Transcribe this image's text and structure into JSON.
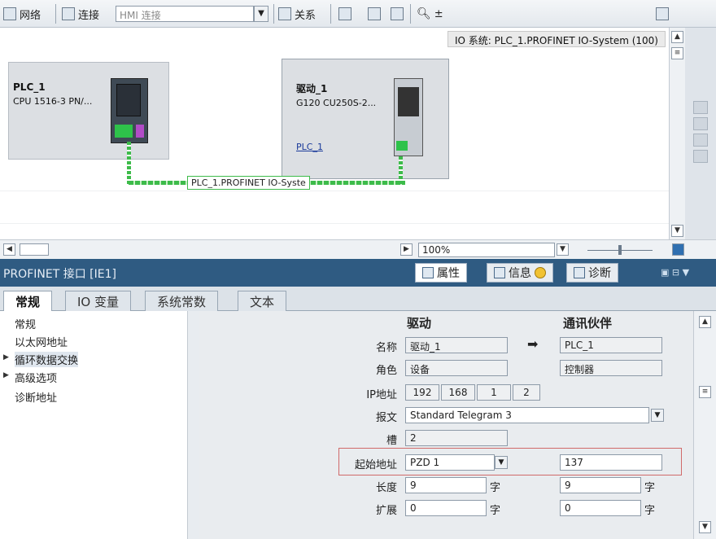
{
  "toolbar": {
    "network_label": "网络",
    "connections_label": "连接",
    "connection_select": "HMI 连接",
    "relations_label": "关系",
    "zoom_plus": "±"
  },
  "netview": {
    "io_system_label": "IO 系统: PLC_1.PROFINET IO-System (100)",
    "plc": {
      "name": "PLC_1",
      "model": "CPU 1516-3 PN/..."
    },
    "drive": {
      "name": "驱动_1",
      "model": "G120 CU250S-2...",
      "link": "PLC_1"
    },
    "network_label": "PLC_1.PROFINET IO-Syste"
  },
  "navbar": {
    "zoom": "100%"
  },
  "properties": {
    "title": "PROFINET 接口 [IE1]",
    "tab_properties": "属性",
    "tab_info": "信息",
    "tab_diagnostics": "诊断"
  },
  "tabs": [
    "常规",
    "IO 变量",
    "系统常数",
    "文本"
  ],
  "tree": [
    {
      "label": "常规",
      "arrow": ""
    },
    {
      "label": "以太网地址",
      "arrow": ""
    },
    {
      "label": "循环数据交换",
      "arrow": "▶"
    },
    {
      "label": "高级选项",
      "arrow": "▶"
    },
    {
      "label": "诊断地址",
      "arrow": ""
    }
  ],
  "exchange": {
    "col_drive": "驱动",
    "col_partner": "通讯伙伴",
    "rows": {
      "name": {
        "label": "名称",
        "drive": "驱动_1",
        "partner": "PLC_1"
      },
      "role": {
        "label": "角色",
        "drive": "设备",
        "partner": "控制器"
      },
      "ip": {
        "label": "IP地址",
        "o1": "192",
        "o2": "168",
        "o3": "1",
        "o4": "2"
      },
      "telegram": {
        "label": "报文",
        "value": "Standard Telegram 3"
      },
      "slot": {
        "label": "槽",
        "value": "2"
      },
      "start": {
        "label": "起始地址",
        "drive": "PZD 1",
        "partner": "137"
      },
      "length": {
        "label": "长度",
        "drive": "9",
        "partner": "9",
        "unit": "字"
      },
      "extension": {
        "label": "扩展",
        "drive": "0",
        "partner": "0",
        "unit": "字"
      }
    },
    "arrow": "➡"
  }
}
